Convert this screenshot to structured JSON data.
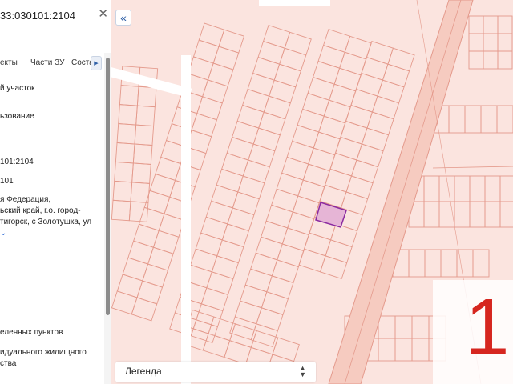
{
  "panel": {
    "cadastral_number": "33:030101:2104",
    "tabs": [
      {
        "label": "екты"
      },
      {
        "label": "Части ЗУ"
      },
      {
        "label": "Состав"
      }
    ],
    "lines": [
      "й участок",
      "ьзование",
      "101:2104",
      "101",
      "я Федерация,\nьский край, г.о. город-\nтигорск, с Золотушка, ул",
      "еленных пунктов",
      "идуального жилищного\nства"
    ]
  },
  "legend": {
    "label": "Легенда"
  },
  "watermark": {
    "text": "1("
  },
  "colors": {
    "map_background": "#fbe4df",
    "parcel_stroke": "#e49a8c",
    "road_fill": "#ffffff",
    "selected_parcel_fill": "#e6b5d6",
    "selected_parcel_stroke": "#8a2aa0",
    "watermark_text": "#d6261f"
  },
  "icons": {
    "collapse": "double-chevron-left-icon",
    "close": "close-icon",
    "tabs_scroll": "triangle-right-icon",
    "expand": "chevron-down-icon",
    "legend_toggle": "chevron-updown-icon"
  }
}
